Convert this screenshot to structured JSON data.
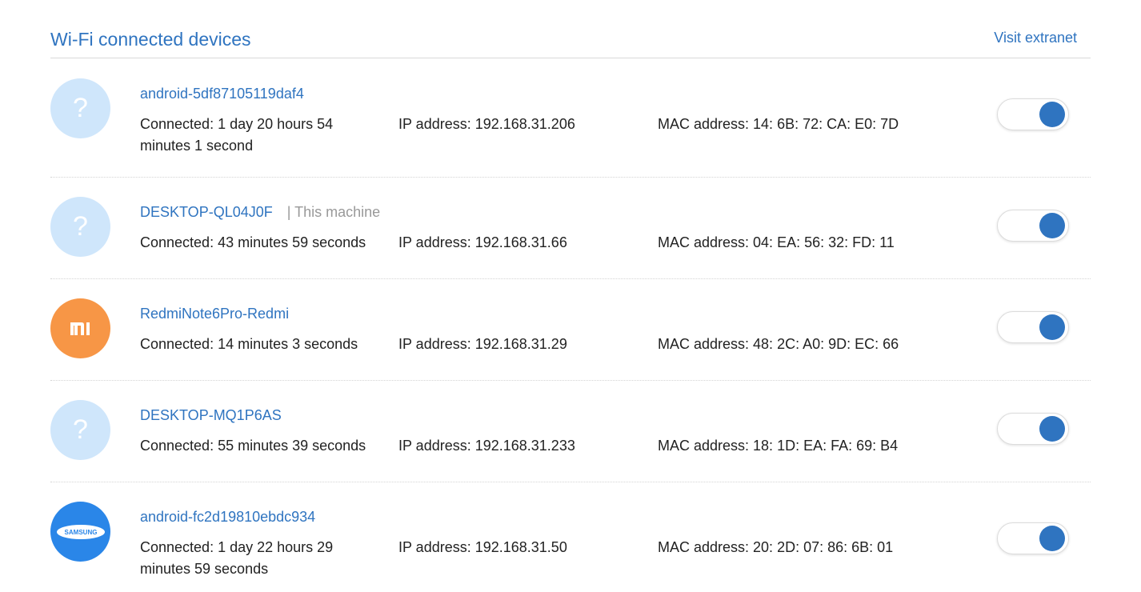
{
  "header": {
    "title": "Wi-Fi connected devices",
    "extranet_link": "Visit extranet"
  },
  "devices": [
    {
      "icon": "unknown-device-icon",
      "glyph": "?",
      "name": "android-5df87105119daf4",
      "tag": "",
      "connected": "Connected: 1 day 20 hours 54 minutes 1 second",
      "ip": "IP address: 192.168.31.206",
      "mac": "MAC address: 14: 6B: 72: CA: E0: 7D",
      "enabled": true
    },
    {
      "icon": "unknown-device-icon",
      "glyph": "?",
      "name": "DESKTOP-QL04J0F",
      "tag": "| This machine",
      "connected": "Connected: 43 minutes 59 seconds",
      "ip": "IP address: 192.168.31.66",
      "mac": "MAC address: 04: EA: 56: 32: FD: 11",
      "enabled": true
    },
    {
      "icon": "xiaomi-logo-icon",
      "glyph": "mi",
      "name": "RedmiNote6Pro-Redmi",
      "tag": "",
      "connected": "Connected: 14 minutes 3 seconds",
      "ip": "IP address: 192.168.31.29",
      "mac": "MAC address: 48: 2C: A0: 9D: EC: 66",
      "enabled": true
    },
    {
      "icon": "unknown-device-icon",
      "glyph": "?",
      "name": "DESKTOP-MQ1P6AS",
      "tag": "",
      "connected": "Connected: 55 minutes 39 seconds",
      "ip": "IP address: 192.168.31.233",
      "mac": "MAC address: 18: 1D: EA: FA: 69: B4",
      "enabled": true
    },
    {
      "icon": "samsung-logo-icon",
      "glyph": "SAMSUNG",
      "name": "android-fc2d19810ebdc934",
      "tag": "",
      "connected": "Connected: 1 day 22 hours 29 minutes 59 seconds",
      "ip": "IP address: 192.168.31.50",
      "mac": "MAC address: 20: 2D: 07: 86: 6B: 01",
      "enabled": true
    }
  ]
}
